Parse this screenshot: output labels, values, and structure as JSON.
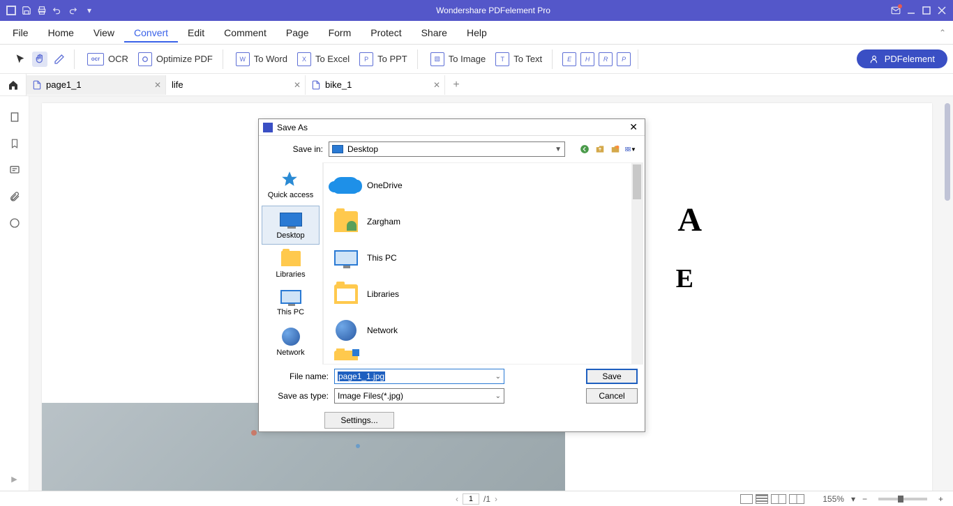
{
  "app": {
    "title": "Wondershare PDFelement Pro"
  },
  "menu": {
    "items": [
      "File",
      "Home",
      "View",
      "Convert",
      "Edit",
      "Comment",
      "Page",
      "Form",
      "Protect",
      "Share",
      "Help"
    ],
    "active_index": 3
  },
  "ribbon": {
    "ocr": "OCR",
    "optimize": "Optimize PDF",
    "to_word": "To Word",
    "to_excel": "To Excel",
    "to_ppt": "To PPT",
    "to_image": "To Image",
    "to_text": "To Text",
    "pdfelement_btn": "PDFelement"
  },
  "tabs": [
    {
      "label": "page1_1",
      "active": true
    },
    {
      "label": "life",
      "active": false
    },
    {
      "label": "bike_1",
      "active": false
    }
  ],
  "doc_content": {
    "letter1": "A",
    "letter2": "E"
  },
  "statusbar": {
    "page_current": "1",
    "page_total": "/1",
    "zoom": "155%"
  },
  "dialog": {
    "title": "Save As",
    "save_in_label": "Save in:",
    "save_in_value": "Desktop",
    "places": [
      {
        "label": "Quick access",
        "type": "quick"
      },
      {
        "label": "Desktop",
        "type": "desktop",
        "selected": true
      },
      {
        "label": "Libraries",
        "type": "lib"
      },
      {
        "label": "This PC",
        "type": "pc"
      },
      {
        "label": "Network",
        "type": "net"
      }
    ],
    "files": [
      {
        "label": "OneDrive",
        "type": "onedrive"
      },
      {
        "label": "Zargham",
        "type": "user"
      },
      {
        "label": "This PC",
        "type": "pc"
      },
      {
        "label": "Libraries",
        "type": "lib"
      },
      {
        "label": "Network",
        "type": "net"
      }
    ],
    "file_name_label": "File name:",
    "file_name_value": "page1_1.jpg",
    "save_type_label": "Save as type:",
    "save_type_value": "Image Files(*.jpg)",
    "save_btn": "Save",
    "cancel_btn": "Cancel",
    "settings_btn": "Settings..."
  }
}
